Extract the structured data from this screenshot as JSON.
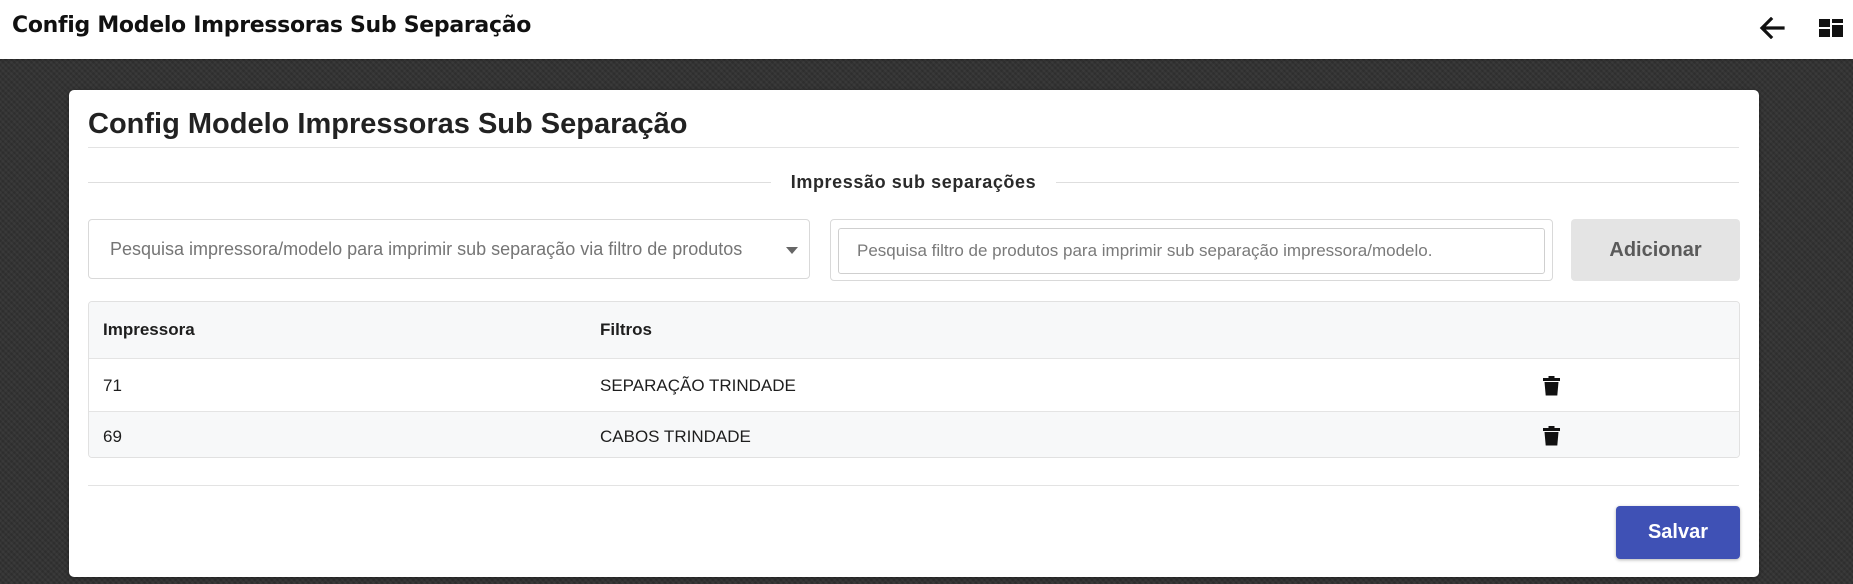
{
  "topbar": {
    "title": "Config Modelo Impressoras Sub Separação",
    "back_icon": "arrow-left-icon",
    "menu_icon": "dashboard-grid-icon"
  },
  "card": {
    "title": "Config Modelo Impressoras Sub Separação",
    "section_label": "Impressão sub separações",
    "printer_select": {
      "placeholder": "Pesquisa impressora/modelo para imprimir sub separação via filtro de produtos",
      "caret_icon": "caret-down-icon"
    },
    "filter_input": {
      "value": "",
      "placeholder": "Pesquisa filtro de produtos para imprimir sub separação impressora/modelo."
    },
    "add_label": "Adicionar",
    "table": {
      "columns": [
        "Impressora",
        "Filtros"
      ],
      "rows": [
        {
          "impressora": "71",
          "filtros": "SEPARAÇÃO TRINDADE",
          "action_icon": "trash-icon"
        },
        {
          "impressora": "69",
          "filtros": "CABOS TRINDADE",
          "action_icon": "trash-icon"
        }
      ]
    },
    "save_label": "Salvar"
  },
  "colors": {
    "primary": "#3f51b5",
    "add_button_bg": "#e4e4e4",
    "background": "#333333"
  }
}
